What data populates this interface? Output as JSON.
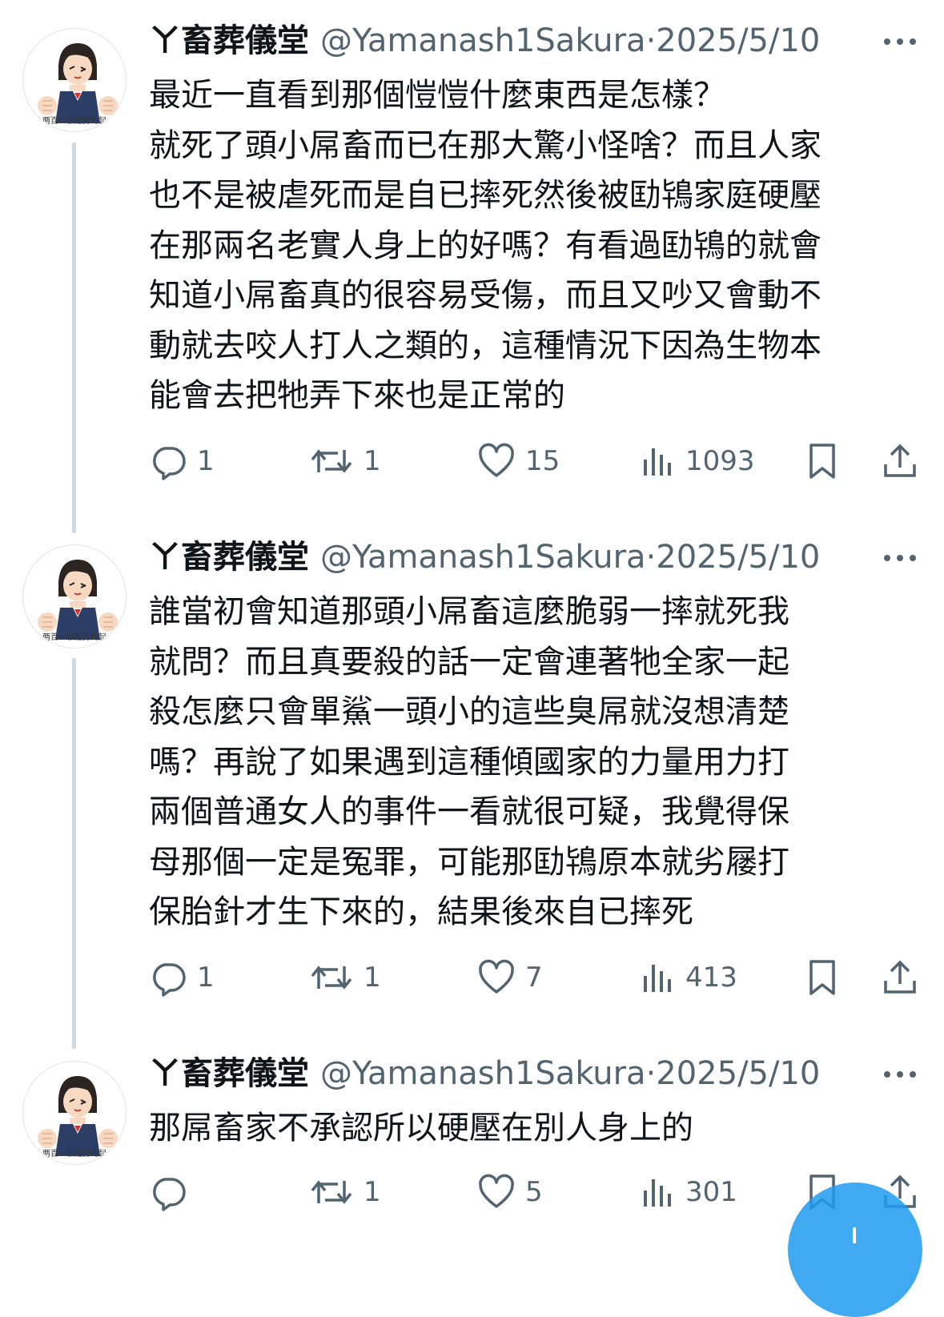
{
  "colors": {
    "accent": "#1d9bf0",
    "muted": "#536471",
    "text": "#0f1419",
    "line": "#cfd9de"
  },
  "tweets": [
    {
      "avatar_caption": "两百一根姐剪的起",
      "name": "ㄚ畜葬儀堂",
      "handle": "@Yamanash1Sakura·2025/5/10",
      "lines": [
        "最近一直看到那個愷愷什麼東西是怎樣？",
        "就死了頭小屌畜而已在那大驚小怪啥？而且人家",
        "也不是被虐死而是自已摔死然後被劻鴇家庭硬壓",
        "在那兩名老實人身上的好嗎？有看過劻鴇的就會",
        "知道小屌畜真的很容易受傷，而且又吵又會動不",
        "動就去咬人打人之類的，這種情況下因為生物本",
        "能會去把牠弄下來也是正常的"
      ],
      "replies": "1",
      "retweets": "1",
      "likes": "15",
      "views": "1093"
    },
    {
      "avatar_caption": "两百一根姐剪的起",
      "name": "ㄚ畜葬儀堂",
      "handle": "@Yamanash1Sakura·2025/5/10",
      "lines": [
        "誰當初會知道那頭小屌畜這麼脆弱一摔就死我",
        "就問？而且真要殺的話一定會連著牠全家一起",
        "殺怎麼只會單鯊一頭小的這些臭屌就沒想清楚",
        "嗎？再說了如果遇到這種傾國家的力量用力打",
        "兩個普通女人的事件一看就很可疑，我覺得保",
        "母那個一定是冤罪，可能那劻鴇原本就劣屦打",
        "保胎針才生下來的，結果後來自已摔死"
      ],
      "replies": "1",
      "retweets": "1",
      "likes": "7",
      "views": "413"
    },
    {
      "avatar_caption": "两百一根姐剪的起",
      "name": "ㄚ畜葬儀堂",
      "handle": "@Yamanash1Sakura·2025/5/10",
      "lines": [
        "那屌畜家不承認所以硬壓在別人身上的"
      ],
      "replies": "",
      "retweets": "1",
      "likes": "5",
      "views": "301"
    }
  ]
}
